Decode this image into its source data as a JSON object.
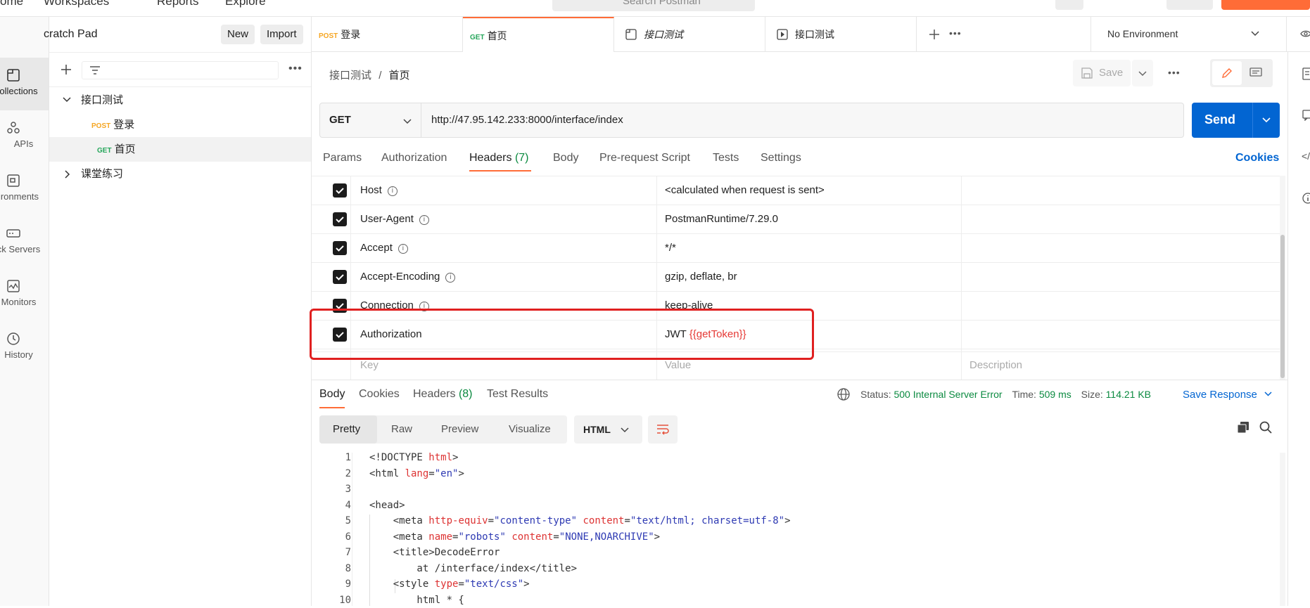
{
  "topbar": {
    "nav": [
      "ome",
      "Workspaces",
      "Reports",
      "Explore"
    ],
    "search_placeholder": "Search Postman"
  },
  "rail": [
    {
      "label": "ollections",
      "icon": "collections-icon"
    },
    {
      "label": "APIs",
      "icon": "apis-icon"
    },
    {
      "label": "ironments",
      "icon": "environments-icon"
    },
    {
      "label": "ck Servers",
      "icon": "mock-servers-icon"
    },
    {
      "label": "Monitors",
      "icon": "monitors-icon"
    },
    {
      "label": "History",
      "icon": "history-icon"
    }
  ],
  "sidebar": {
    "title": "cratch Pad",
    "new_label": "New",
    "import_label": "Import",
    "tree": [
      {
        "label": "接口测试",
        "method": "",
        "expanded": true
      },
      {
        "label": "登录",
        "method": "POST"
      },
      {
        "label": "首页",
        "method": "GET"
      },
      {
        "label": "课堂练习",
        "method": "",
        "expanded": false
      }
    ]
  },
  "tabs": [
    {
      "method": "POST",
      "label": "登录"
    },
    {
      "method": "GET",
      "label": "首页"
    },
    {
      "method": "",
      "label": "接口测试"
    },
    {
      "method": "",
      "label": "接口测试"
    }
  ],
  "environment": "No Environment",
  "breadcrumb": {
    "parent": "接口测试",
    "sep": "/",
    "current": "首页"
  },
  "save_label": "Save",
  "request": {
    "method": "GET",
    "url": "http://47.95.142.233:8000/interface/index",
    "send_label": "Send"
  },
  "req_tabs": {
    "params": "Params",
    "authorization": "Authorization",
    "headers": "Headers",
    "headers_count": "(7)",
    "body": "Body",
    "prerequest": "Pre-request Script",
    "tests": "Tests",
    "settings": "Settings",
    "cookies": "Cookies"
  },
  "headers": [
    {
      "key": "Host",
      "value": "<calculated when request is sent>",
      "info": true
    },
    {
      "key": "User-Agent",
      "value": "PostmanRuntime/7.29.0",
      "info": true
    },
    {
      "key": "Accept",
      "value": "*/*",
      "info": true
    },
    {
      "key": "Accept-Encoding",
      "value": "gzip, deflate, br",
      "info": true
    },
    {
      "key": "Connection",
      "value": "keep-alive",
      "info": true
    },
    {
      "key": "Authorization",
      "value_prefix": "JWT ",
      "value_var": "{{getToken}}",
      "info": false
    }
  ],
  "header_placeholders": {
    "key": "Key",
    "value": "Value",
    "description": "Description"
  },
  "response": {
    "tabs": {
      "body": "Body",
      "cookies": "Cookies",
      "headers": "Headers",
      "headers_count": "(8)",
      "tests": "Test Results"
    },
    "status_label": "Status:",
    "status_value": "500 Internal Server Error",
    "time_label": "Time:",
    "time_value": "509 ms",
    "size_label": "Size:",
    "size_value": "114.21 KB",
    "save_response": "Save Response",
    "view_modes": [
      "Pretty",
      "Raw",
      "Preview",
      "Visualize"
    ],
    "format": "HTML"
  },
  "code_lines": [
    {
      "n": "1",
      "parts": [
        [
          "tg",
          "<!DOCTYPE "
        ],
        [
          "at",
          "html"
        ],
        [
          "tg",
          ">"
        ]
      ]
    },
    {
      "n": "2",
      "parts": [
        [
          "tg",
          "<html "
        ],
        [
          "at",
          "lang"
        ],
        [
          "tg",
          "="
        ],
        [
          "st",
          "\"en\""
        ],
        [
          "tg",
          ">"
        ]
      ]
    },
    {
      "n": "3",
      "parts": []
    },
    {
      "n": "4",
      "parts": [
        [
          "tg",
          "<head>"
        ]
      ]
    },
    {
      "n": "5",
      "parts": [
        [
          "tg",
          "    <meta "
        ],
        [
          "at",
          "http-equiv"
        ],
        [
          "tg",
          "="
        ],
        [
          "st",
          "\"content-type\""
        ],
        [
          "tg",
          " "
        ],
        [
          "at",
          "content"
        ],
        [
          "tg",
          "="
        ],
        [
          "st",
          "\"text/html; charset=utf-8\""
        ],
        [
          "tg",
          ">"
        ]
      ]
    },
    {
      "n": "6",
      "parts": [
        [
          "tg",
          "    <meta "
        ],
        [
          "at",
          "name"
        ],
        [
          "tg",
          "="
        ],
        [
          "st",
          "\"robots\""
        ],
        [
          "tg",
          " "
        ],
        [
          "at",
          "content"
        ],
        [
          "tg",
          "="
        ],
        [
          "st",
          "\"NONE,NOARCHIVE\""
        ],
        [
          "tg",
          ">"
        ]
      ]
    },
    {
      "n": "7",
      "parts": [
        [
          "tg",
          "    <title>DecodeError"
        ]
      ]
    },
    {
      "n": "8",
      "parts": [
        [
          "tg",
          "        at /interface/index</title>"
        ]
      ]
    },
    {
      "n": "9",
      "parts": [
        [
          "tg",
          "    <style "
        ],
        [
          "at",
          "type"
        ],
        [
          "tg",
          "="
        ],
        [
          "st",
          "\"text/css\""
        ],
        [
          "tg",
          ">"
        ]
      ]
    },
    {
      "n": "10",
      "parts": [
        [
          "tg",
          "        html * {"
        ]
      ]
    }
  ],
  "colors": {
    "accent": "#ff6c37",
    "send": "#0265d2",
    "status_ok": "#0b8a40",
    "var_red": "#e53935",
    "highlight_box": "#e02020"
  }
}
